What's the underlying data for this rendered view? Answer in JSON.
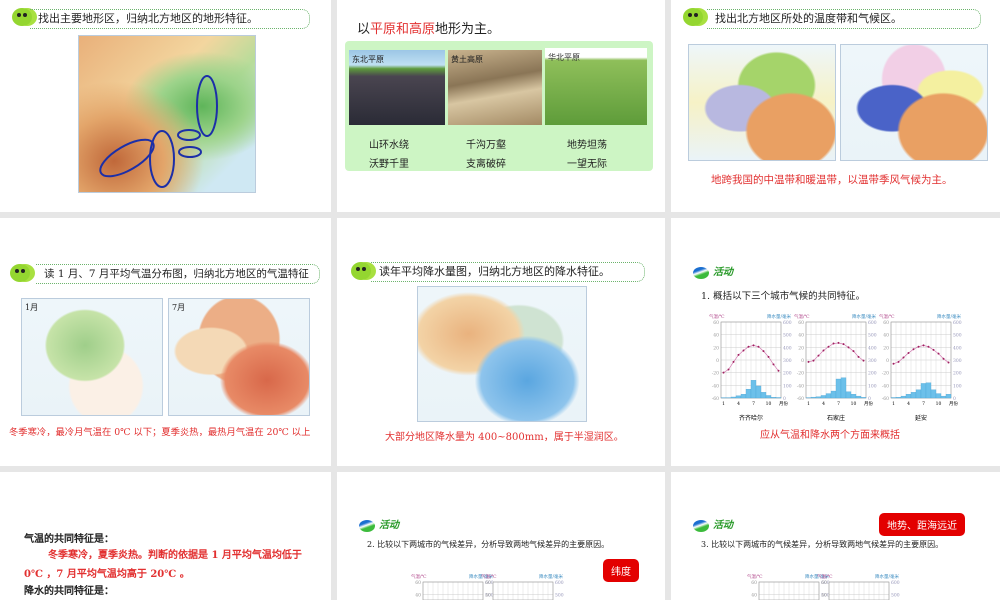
{
  "slide1": {
    "prompt": "找出主要地形区，归纳北方地区的地形特征。"
  },
  "slide2": {
    "title_pre": "以",
    "title_hl": "平原和高原",
    "title_post": "地形为主。",
    "photos": [
      {
        "label": "东北平原",
        "phrases": [
          "山环水绕",
          "沃野千里"
        ]
      },
      {
        "label": "黄土高原",
        "phrases": [
          "千沟万壑",
          "支离破碎"
        ]
      },
      {
        "label": "华北平原",
        "phrases": [
          "地势坦荡",
          "一望无际"
        ]
      }
    ],
    "panel_color": "#cdf5c4"
  },
  "slide3": {
    "prompt": "找出北方地区所处的温度带和气候区。",
    "conclusion": "地跨我国的中温带和暖温带，以温带季风气候为主。"
  },
  "slide4": {
    "prompt": "读 1 月、7 月平均气温分布图，归纳北方地区的气温特征",
    "map_labels": [
      "1月",
      "7月"
    ],
    "conclusion": "冬季寒冷，最冷月气温在 0℃ 以下；夏季炎热，最热月气温在 20℃ 以上"
  },
  "slide5": {
    "prompt": "读年平均降水量图，归纳北方地区的降水特征。",
    "conclusion": "大部分地区降水量为 400~800mm，属于半湿润区。"
  },
  "slide6": {
    "activity": "活动",
    "question": "1. 概括以下三个城市气候的共同特征。",
    "conclusion": "应从气温和降水两个方面来概括",
    "temp_axis_label": "气温/℃",
    "precip_axis_label": "降水量/毫米",
    "month_unit": "月份"
  },
  "slide7": {
    "heading": "气温的共同特征是：",
    "body": "冬季寒冷，夏季炎热。判断的依据是 1 月平均气温均低于 0℃ ，7 月平均气温均高于 20℃ 。",
    "heading2": "降水的共同特征是："
  },
  "slide8": {
    "activity": "活动",
    "question": "2. 比较以下两城市的气候差异，分析导致两地气候差异的主要原因。",
    "callout": "纬度"
  },
  "slide9": {
    "activity": "活动",
    "question": "3. 比较以下两城市的气候差异，分析导致两地气候差异的主要原因。",
    "callout": "地势、距海远近"
  },
  "chart_data": [
    {
      "type": "line+bar",
      "title": "齐齐哈尔",
      "x": [
        1,
        2,
        3,
        4,
        5,
        6,
        7,
        8,
        9,
        10,
        11,
        12
      ],
      "temperature": [
        -20,
        -15,
        -3,
        8,
        15,
        21,
        23,
        21,
        14,
        5,
        -7,
        -17
      ],
      "precipitation": [
        3,
        3,
        8,
        18,
        30,
        70,
        140,
        95,
        45,
        20,
        6,
        4
      ],
      "ylim_temp": [
        -60,
        60
      ],
      "ylim_precip": [
        0,
        600
      ],
      "xticks": [
        "1",
        "4",
        "7",
        "10"
      ]
    },
    {
      "type": "line+bar",
      "title": "石家庄",
      "x": [
        1,
        2,
        3,
        4,
        5,
        6,
        7,
        8,
        9,
        10,
        11,
        12
      ],
      "temperature": [
        -3,
        -1,
        7,
        15,
        21,
        26,
        27,
        25,
        20,
        14,
        5,
        -1
      ],
      "precipitation": [
        3,
        7,
        10,
        20,
        35,
        55,
        150,
        160,
        50,
        30,
        15,
        5
      ],
      "ylim_temp": [
        -60,
        60
      ],
      "ylim_precip": [
        0,
        600
      ],
      "xticks": [
        "1",
        "4",
        "7",
        "10"
      ]
    },
    {
      "type": "line+bar",
      "title": "延安",
      "x": [
        1,
        2,
        3,
        4,
        5,
        6,
        7,
        8,
        9,
        10,
        11,
        12
      ],
      "temperature": [
        -6,
        -3,
        4,
        11,
        17,
        21,
        23,
        21,
        16,
        10,
        2,
        -4
      ],
      "precipitation": [
        4,
        6,
        15,
        30,
        45,
        65,
        115,
        120,
        65,
        35,
        15,
        30
      ],
      "ylim_temp": [
        -60,
        60
      ],
      "ylim_precip": [
        0,
        600
      ],
      "xticks": [
        "1",
        "4",
        "7",
        "10"
      ]
    }
  ]
}
